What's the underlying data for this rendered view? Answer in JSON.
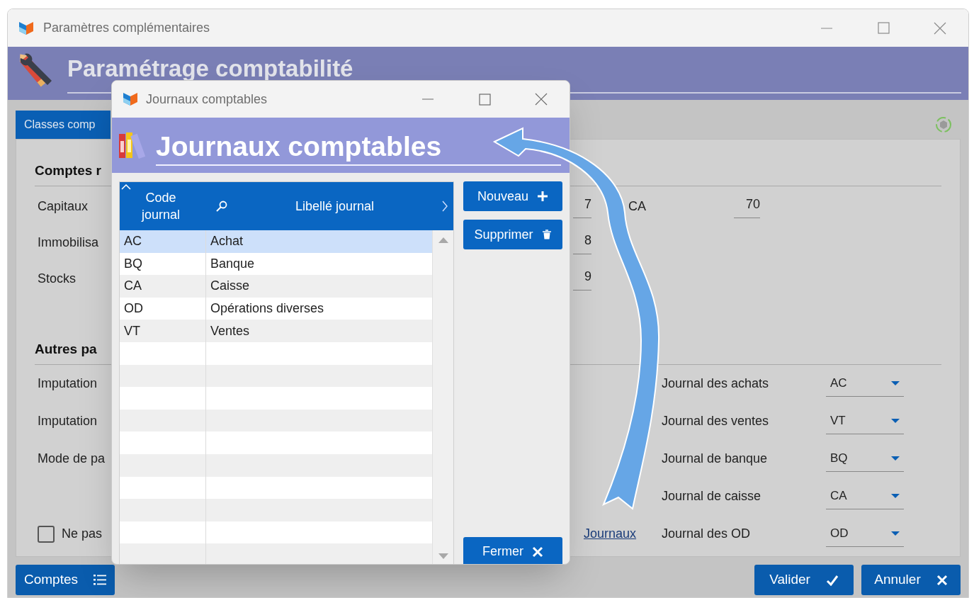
{
  "window": {
    "title": "Paramètres complémentaires"
  },
  "header": {
    "title": "Paramétrage comptabilité"
  },
  "tabs": [
    {
      "label": "Classes comp",
      "selected": true
    }
  ],
  "accounts_section": {
    "title": "Comptes r",
    "rows": [
      {
        "label": "Capitaux",
        "value": "7",
        "extra_label": "CA",
        "extra_value": "70"
      },
      {
        "label": "Immobilisa",
        "value": "8"
      },
      {
        "label": "Stocks",
        "value": "9"
      }
    ]
  },
  "other_section": {
    "title": "Autres pa",
    "left_fields": [
      {
        "label": "Imputation"
      },
      {
        "label": "Imputation"
      },
      {
        "label": "Mode de pa"
      }
    ],
    "checkbox": {
      "label": "Ne pas",
      "checked": false
    },
    "link": "Journaux",
    "journals": [
      {
        "label": "Journal des achats",
        "value": "AC"
      },
      {
        "label": "Journal des ventes",
        "value": "VT"
      },
      {
        "label": "Journal de banque",
        "value": "BQ"
      },
      {
        "label": "Journal de caisse",
        "value": "CA"
      },
      {
        "label": "Journal des OD",
        "value": "OD"
      }
    ]
  },
  "footer_buttons": [
    {
      "label": "Comptes"
    },
    {
      "label": "Valider"
    },
    {
      "label": "Annuler"
    }
  ],
  "dialog": {
    "title": "Journaux comptables",
    "header": "Journaux comptables",
    "table": {
      "columns": [
        "Code journal",
        "Libellé journal"
      ],
      "rows": [
        {
          "code": "AC",
          "label": "Achat",
          "selected": true
        },
        {
          "code": "BQ",
          "label": "Banque",
          "selected": false
        },
        {
          "code": "CA",
          "label": "Caisse",
          "selected": false
        },
        {
          "code": "OD",
          "label": "Opérations diverses",
          "selected": false
        },
        {
          "code": "VT",
          "label": "Ventes",
          "selected": false
        }
      ]
    },
    "buttons": [
      {
        "label": "Nouveau"
      },
      {
        "label": "Supprimer"
      },
      {
        "label": "Fermer"
      }
    ]
  }
}
